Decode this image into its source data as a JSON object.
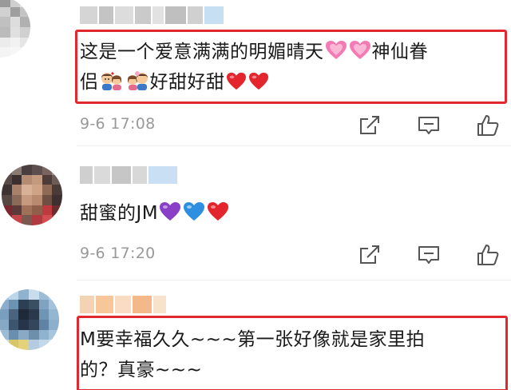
{
  "comments": [
    {
      "text_line1": "这是一个爱意满满的明媚晴天",
      "text_line1_tail": "神仙眷",
      "text_line2_head": "侣",
      "text_line2_tail": "好甜好甜",
      "time": "9-6 17:08",
      "emojis": [
        "pink-heart",
        "pink-heart",
        "couple",
        "couple",
        "red-heart",
        "red-heart"
      ]
    },
    {
      "text": "甜蜜的JM",
      "time": "9-6 17:20",
      "emojis": [
        "purple-heart",
        "blue-heart",
        "red-heart"
      ]
    },
    {
      "text_line1": "M要幸福久久~~~第一张好像就是家里拍",
      "text_line2": "的？真豪~~~"
    }
  ],
  "actions": [
    "share-icon",
    "comment-icon",
    "like-icon"
  ],
  "colors": {
    "highlight": "#e0282e",
    "time": "#999999",
    "pink_heart": "#f47ab3",
    "red_heart": "#e3262e",
    "purple_heart": "#8a3fc7",
    "blue_heart": "#2e8fe0"
  }
}
